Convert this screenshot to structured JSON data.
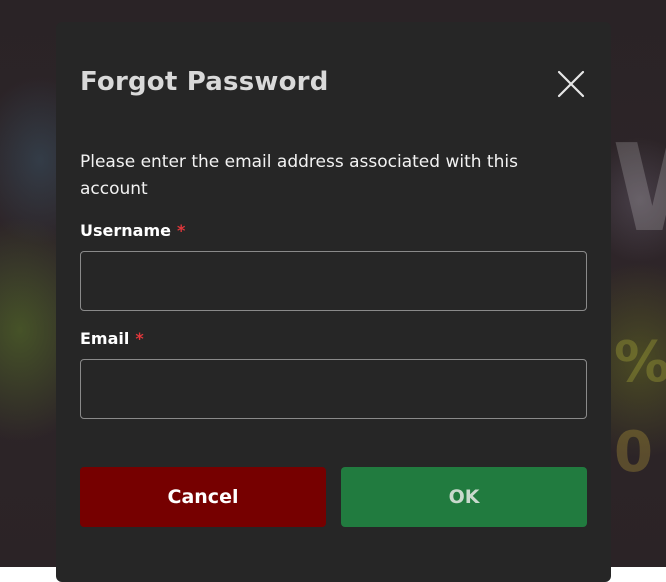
{
  "dialog": {
    "title": "Forgot Password",
    "close_icon": "close-icon",
    "description": "Please enter the email address associated with this account",
    "fields": [
      {
        "label": "Username",
        "required_mark": "*",
        "value": "",
        "placeholder": ""
      },
      {
        "label": "Email",
        "required_mark": "*",
        "value": "",
        "placeholder": ""
      }
    ],
    "buttons": {
      "cancel_label": "Cancel",
      "ok_label": "OK"
    }
  },
  "colors": {
    "dialog_bg": "#262626",
    "cancel_bg": "#760000",
    "ok_bg": "#217b3f",
    "required": "#e0373b"
  }
}
